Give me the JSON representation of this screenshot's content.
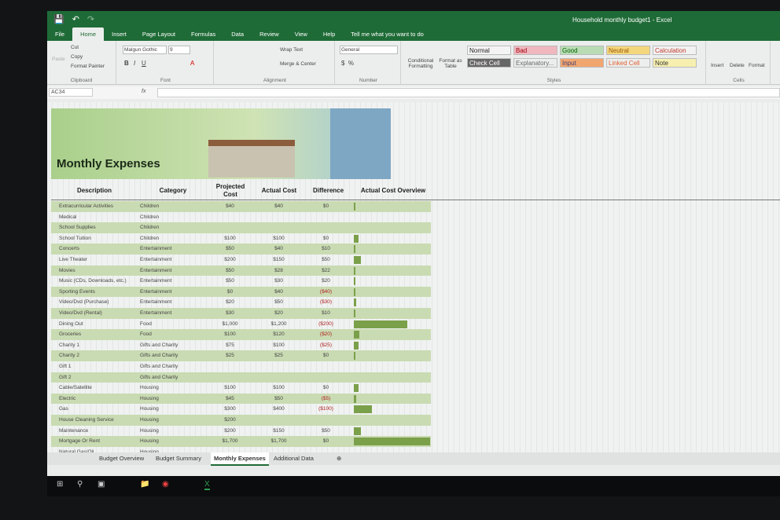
{
  "window": {
    "title": "Household monthly budget1  -  Excel"
  },
  "ribbon_tabs": [
    "File",
    "Home",
    "Insert",
    "Page Layout",
    "Formulas",
    "Data",
    "Review",
    "View",
    "Help",
    "Tell me what you want to do"
  ],
  "clipboard": {
    "paste": "Paste",
    "cut": "Cut",
    "copy": "Copy",
    "format_painter": "Format Painter",
    "label": "Clipboard"
  },
  "font": {
    "name": "Malgun Gothic",
    "size": "9",
    "label": "Font"
  },
  "alignment": {
    "wrap": "Wrap Text",
    "merge": "Merge & Center",
    "label": "Alignment"
  },
  "number": {
    "format": "General",
    "label": "Number"
  },
  "styles": {
    "conditional": "Conditional Formatting",
    "format_table": "Format as Table",
    "label": "Styles",
    "items": [
      {
        "label": "Normal",
        "bg": "#f4f4f4",
        "fg": "#222"
      },
      {
        "label": "Bad",
        "bg": "#f1b7bf",
        "fg": "#9c0006"
      },
      {
        "label": "Good",
        "bg": "#b9dcb4",
        "fg": "#006100"
      },
      {
        "label": "Neutral",
        "bg": "#f4d67d",
        "fg": "#9c5700"
      },
      {
        "label": "Calculation",
        "bg": "#f2f2f2",
        "fg": "#c0392b"
      },
      {
        "label": "Check Cell",
        "bg": "#666",
        "fg": "#fff"
      },
      {
        "label": "Explanatory...",
        "bg": "#eceeed",
        "fg": "#666"
      },
      {
        "label": "Input",
        "bg": "#f1a670",
        "fg": "#3f3f76"
      },
      {
        "label": "Linked Cell",
        "bg": "#eceeed",
        "fg": "#e06030"
      },
      {
        "label": "Note",
        "bg": "#f6efb0",
        "fg": "#333"
      }
    ]
  },
  "cells": {
    "insert": "Insert",
    "delete": "Delete",
    "format": "Format",
    "label": "Cells"
  },
  "formula_bar": {
    "name_box": "AC34",
    "fx": "fx"
  },
  "sheet": {
    "banner_title": "Monthly Expenses",
    "headers": [
      "Description",
      "Category",
      "Projected Cost",
      "Actual Cost",
      "Difference",
      "Actual Cost Overview"
    ],
    "rows": [
      [
        "Extracurricular Activities",
        "Children",
        "$40",
        "$40",
        "$0",
        40
      ],
      [
        "Medical",
        "Children",
        "",
        "",
        "",
        0
      ],
      [
        "School Supplies",
        "Children",
        "",
        "",
        "",
        0
      ],
      [
        "School Tuition",
        "Children",
        "$100",
        "$100",
        "$0",
        100
      ],
      [
        "Concerts",
        "Entertainment",
        "$50",
        "$40",
        "$10",
        40
      ],
      [
        "Live Theater",
        "Entertainment",
        "$200",
        "$150",
        "$50",
        150
      ],
      [
        "Movies",
        "Entertainment",
        "$50",
        "$28",
        "$22",
        28
      ],
      [
        "Music (CDs, Downloads, etc.)",
        "Entertainment",
        "$50",
        "$30",
        "$20",
        30
      ],
      [
        "Sporting Events",
        "Entertainment",
        "$0",
        "$40",
        "($40)",
        40
      ],
      [
        "Video/Dvd (Purchase)",
        "Entertainment",
        "$20",
        "$50",
        "($30)",
        50
      ],
      [
        "Video/Dvd (Rental)",
        "Entertainment",
        "$30",
        "$20",
        "$10",
        20
      ],
      [
        "Dining Out",
        "Food",
        "$1,000",
        "$1,200",
        "($200)",
        1200
      ],
      [
        "Groceries",
        "Food",
        "$100",
        "$120",
        "($20)",
        120
      ],
      [
        "Charity 1",
        "Gifts and Charity",
        "$75",
        "$100",
        "($25)",
        100
      ],
      [
        "Charity 2",
        "Gifts and Charity",
        "$25",
        "$25",
        "$0",
        25
      ],
      [
        "Gift 1",
        "Gifts and Charity",
        "",
        "",
        "",
        0
      ],
      [
        "Gift 2",
        "Gifts and Charity",
        "",
        "",
        "",
        0
      ],
      [
        "Cable/Satellite",
        "Housing",
        "$100",
        "$100",
        "$0",
        100
      ],
      [
        "Electric",
        "Housing",
        "$45",
        "$50",
        "($5)",
        50
      ],
      [
        "Gas",
        "Housing",
        "$300",
        "$400",
        "($100)",
        400
      ],
      [
        "House Cleaning Service",
        "Housing",
        "$200",
        "",
        "",
        0
      ],
      [
        "Maintenance",
        "Housing",
        "$200",
        "$150",
        "$50",
        150
      ],
      [
        "Mortgage Or Rent",
        "Housing",
        "$1,700",
        "$1,700",
        "$0",
        1700
      ],
      [
        "Natural Gas/Oil",
        "Housing",
        "",
        "",
        "",
        0
      ]
    ]
  },
  "sheet_tabs": [
    "Budget Overview",
    "Budget Summary",
    "Monthly Expenses",
    "Additional Data"
  ],
  "active_sheet": "Monthly Expenses",
  "colors": {
    "accent": "#1f6b37",
    "bar": "#7ba04a",
    "negative": "#b02020"
  }
}
